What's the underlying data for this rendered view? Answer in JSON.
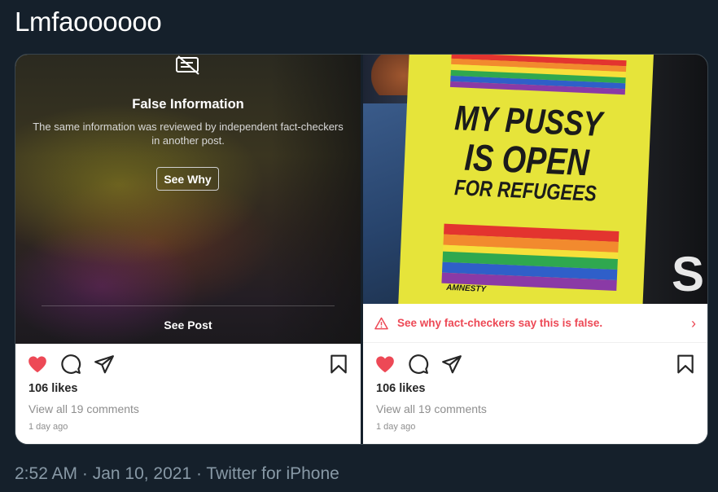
{
  "tweet": {
    "text": "Lmfaoooooo",
    "meta": "2:52 AM · Jan 10, 2021 · Twitter for iPhone"
  },
  "left_post": {
    "overlay": {
      "icon": "fact-check-icon",
      "title": "False Information",
      "description": "The same information was reviewed by independent fact-checkers in another post.",
      "button_label": "See Why",
      "see_post_label": "See Post"
    },
    "likes": "106 likes",
    "comments": "View all 19 comments",
    "time_ago": "1 day ago"
  },
  "right_post": {
    "sign": {
      "line1": "MY PUSSY",
      "line2": "IS OPEN",
      "line3": "FOR REFUGEES",
      "logo_text": "AMNESTY"
    },
    "background_letter": "S",
    "fact_check_banner": "See why fact-checkers say this is false.",
    "likes": "106 likes",
    "comments": "View all 19 comments",
    "time_ago": "1 day ago"
  },
  "icons": {
    "like": "heart-icon",
    "comment": "comment-icon",
    "share": "share-icon",
    "save": "bookmark-icon",
    "warning": "warning-icon",
    "chevron": "chevron-right-icon"
  },
  "colors": {
    "background": "#15202b",
    "like_red": "#ed4956",
    "meta_gray": "#8899a6"
  }
}
